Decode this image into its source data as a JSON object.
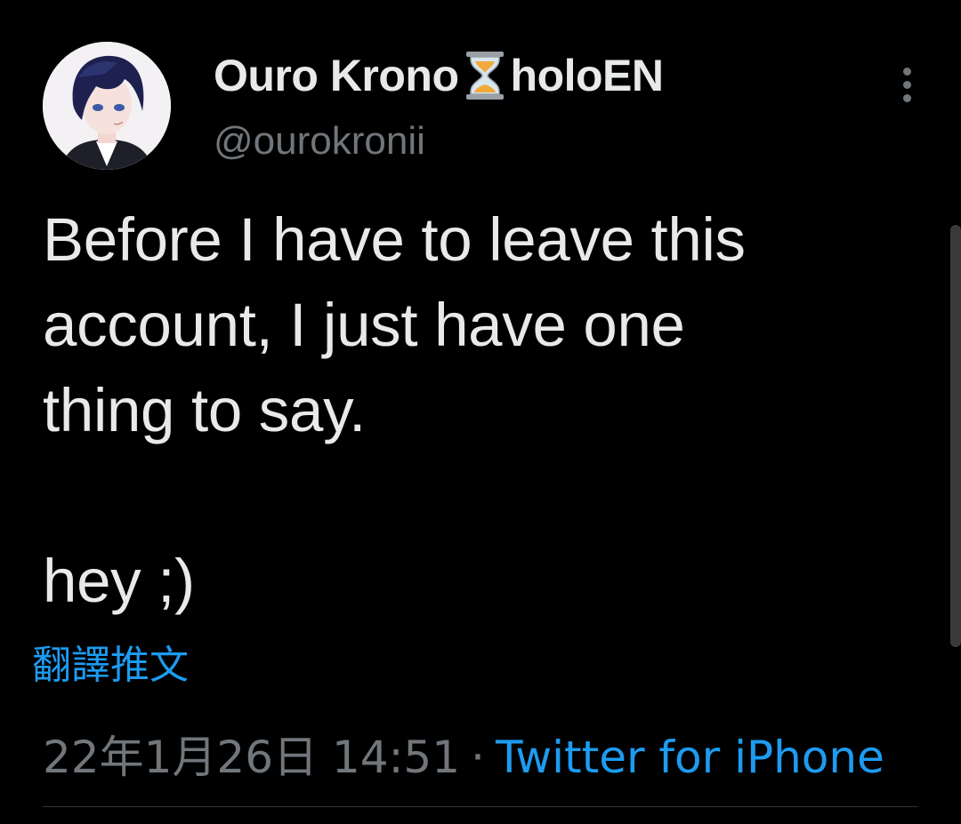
{
  "user": {
    "display_name_first": "Ouro Krono",
    "display_name_emoji": "hourglass-icon",
    "display_name_second": "holoEN",
    "handle": "@ourokronii"
  },
  "tweet": {
    "text": "Before I have to leave this\naccount, I just have one\nthing to say.\n\nhey ;)",
    "translate_label": "翻譯推文",
    "date": "22年1月26日 14:51",
    "separator": "·",
    "source": "Twitter for iPhone"
  },
  "colors": {
    "background": "#000000",
    "primary_text": "#e7e9ea",
    "secondary_text": "#71767b",
    "link": "#1d9bf0"
  }
}
